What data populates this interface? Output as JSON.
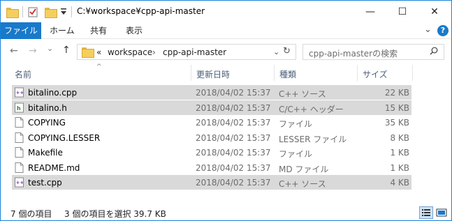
{
  "window": {
    "title": "C:¥workspace¥cpp-api-master",
    "controls": [
      "—",
      "☐",
      "✕"
    ]
  },
  "ribbon": {
    "tabs": [
      "ファイル",
      "ホーム",
      "共有",
      "表示"
    ],
    "collapse_glyph": "⌄",
    "help_glyph": "?"
  },
  "nav": {
    "back_glyph": "←",
    "forward_glyph": "→",
    "recent_glyph": "⌄",
    "up_glyph": "↑",
    "overflow_glyph": "«",
    "breadcrumb": [
      "workspace",
      "cpp-api-master"
    ],
    "crumb_sep": "›",
    "dropdown_glyph": "⌄",
    "refresh_glyph": "↻",
    "search_placeholder": "cpp-api-masterの検索"
  },
  "columns": {
    "name": "名前",
    "date": "更新日時",
    "type": "種類",
    "size": "サイズ",
    "sort_glyph": "^"
  },
  "files": [
    {
      "name": "bitalino.cpp",
      "date": "2018/04/02 15:37",
      "type": "C++ ソース",
      "size": "22 KB",
      "icon": "cpp-file-icon",
      "selected": true
    },
    {
      "name": "bitalino.h",
      "date": "2018/04/02 15:37",
      "type": "C/C++ ヘッダー",
      "size": "15 KB",
      "icon": "header-file-icon",
      "selected": true
    },
    {
      "name": "COPYING",
      "date": "2018/04/02 15:37",
      "type": "ファイル",
      "size": "35 KB",
      "icon": "file-icon",
      "selected": false
    },
    {
      "name": "COPYING.LESSER",
      "date": "2018/04/02 15:37",
      "type": "LESSER ファイル",
      "size": "8 KB",
      "icon": "file-icon",
      "selected": false
    },
    {
      "name": "Makefile",
      "date": "2018/04/02 15:37",
      "type": "ファイル",
      "size": "1 KB",
      "icon": "file-icon",
      "selected": false
    },
    {
      "name": "README.md",
      "date": "2018/04/02 15:37",
      "type": "MD ファイル",
      "size": "1 KB",
      "icon": "file-icon",
      "selected": false
    },
    {
      "name": "test.cpp",
      "date": "2018/04/02 15:37",
      "type": "C++ ソース",
      "size": "4 KB",
      "icon": "cpp-file-icon",
      "selected": true
    }
  ],
  "status": {
    "item_count": "7 個の項目",
    "selection": "3 個の項目を選択  39.7 KB"
  },
  "colors": {
    "accent": "#1979ca",
    "selected_row": "#d9d9d9",
    "border": "#1883d7"
  }
}
